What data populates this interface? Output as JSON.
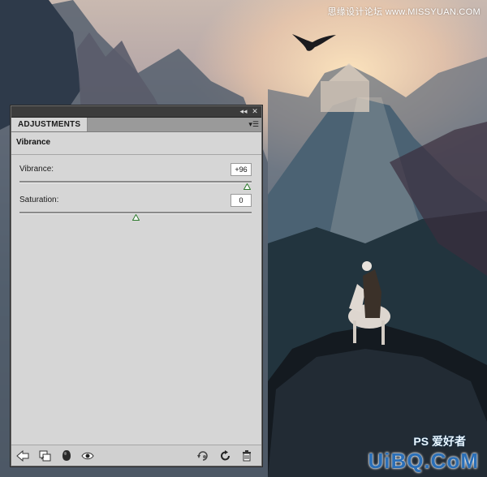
{
  "watermarks": {
    "top": "思缘设计论坛 www.MISSYUAN.COM",
    "ps_badge": "PS 爱好者",
    "bottom": "UiBQ.CoM"
  },
  "panel": {
    "tab_label": "ADJUSTMENTS",
    "header_title": "Vibrance",
    "controls": [
      {
        "label": "Vibrance:",
        "value": "+96",
        "level_percent": 98
      },
      {
        "label": "Saturation:",
        "value": "0",
        "level_percent": 50
      }
    ],
    "footer_icons": [
      "back-arrow-icon",
      "clip-layer-icon",
      "mask-visibility-icon",
      "eye-icon",
      "view-previous-icon",
      "reset-icon",
      "trash-icon"
    ]
  },
  "colors": {
    "panel_bg": "#d6d6d6",
    "titlebar_bg": "#3c3c3c",
    "thumb_green": "#2d7a2d"
  }
}
